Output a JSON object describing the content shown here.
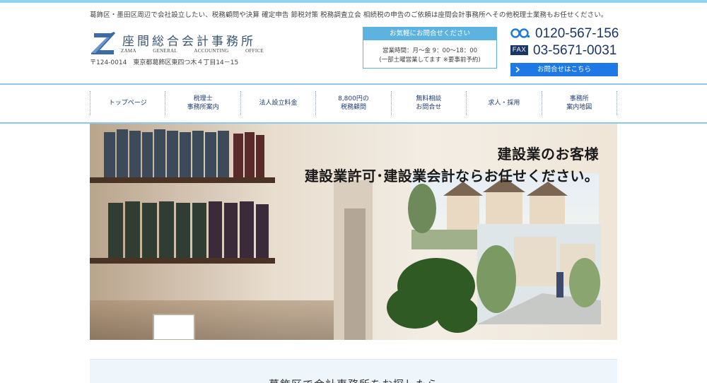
{
  "header": {
    "tagline": "葛飾区・墨田区周辺で会社設立したい、税務顧問や決算 確定申告 節税対策 税務調査立会 相続税の申告のご依頼は座間会計事務所へその他税理士業務もお任せください。",
    "logo": {
      "title": "座間総合会計事務所",
      "subtitle_words": [
        "ZAMA",
        "GENERAL",
        "ACCOUNTING",
        "OFFICE"
      ]
    },
    "address": "〒124-0014　東京都葛飾区東四つ木４丁目14－15",
    "contact_box": {
      "heading": "お気軽にお問合せください",
      "hours": "営業時間：月〜金 9：00〜18：00",
      "note": "(一部土曜営業してます ※要事前予約)"
    },
    "tel": {
      "icon": "freedial-icon",
      "number": "0120-567-156"
    },
    "fax": {
      "label": "FAX",
      "number": "03-5671-0031"
    },
    "inquiry_button": "お問合せはこちら"
  },
  "nav": {
    "items": [
      {
        "name": "nav-top-page",
        "label": "トップページ"
      },
      {
        "name": "nav-tax-office",
        "label": "税理士\n事務所案内"
      },
      {
        "name": "nav-incorporation-fee",
        "label": "法人設立料金"
      },
      {
        "name": "nav-advisory",
        "label": "8,800円の\n税務顧問"
      },
      {
        "name": "nav-free-consult",
        "label": "無料相談\nお問合せ"
      },
      {
        "name": "nav-recruit",
        "label": "求人・採用"
      },
      {
        "name": "nav-map",
        "label": "事務所\n案内地図"
      }
    ]
  },
  "hero": {
    "line1": "建設業のお客様",
    "line2": "建設業許可･建設業会計ならお任せください。"
  },
  "intro": {
    "text": "葛飾区で会計事務所をお探したら"
  },
  "colors": {
    "accent": "#5cb3e0",
    "navy": "#1b3564",
    "button": "#1e78e6"
  }
}
